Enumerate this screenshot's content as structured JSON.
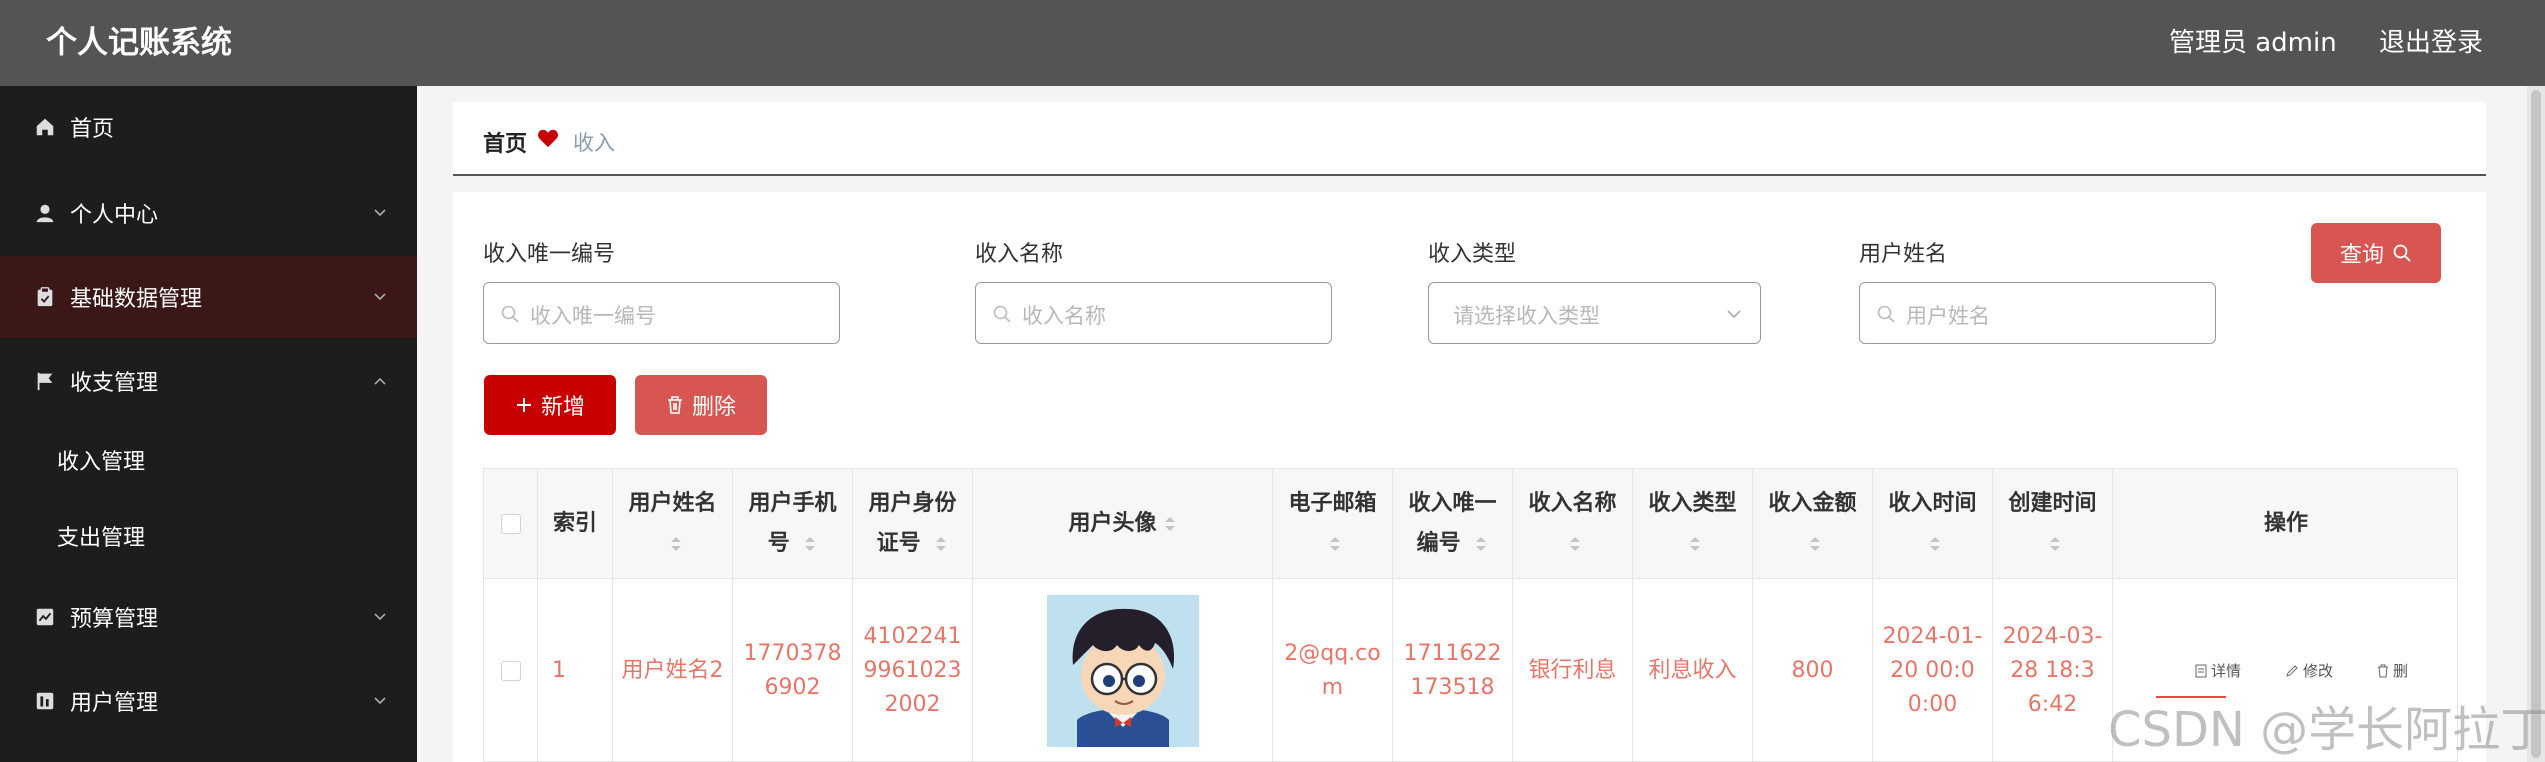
{
  "header": {
    "title": "个人记账系统",
    "user_label": "管理员 admin",
    "logout_label": "退出登录"
  },
  "sidebar": {
    "items": [
      {
        "label": "首页",
        "icon": "home-icon"
      },
      {
        "label": "个人中心",
        "icon": "user-icon"
      },
      {
        "label": "基础数据管理",
        "icon": "clipboard-icon"
      },
      {
        "label": "收支管理",
        "icon": "flag-icon"
      },
      {
        "label": "预算管理",
        "icon": "chart-icon"
      },
      {
        "label": "用户管理",
        "icon": "users-icon"
      }
    ],
    "sub_items": [
      "收入管理",
      "支出管理"
    ]
  },
  "breadcrumb": {
    "home": "首页",
    "current": "收入"
  },
  "search": {
    "fields": [
      {
        "label": "收入唯一编号",
        "placeholder": "收入唯一编号"
      },
      {
        "label": "收入名称",
        "placeholder": "收入名称"
      },
      {
        "label": "收入类型",
        "placeholder": "请选择收入类型"
      },
      {
        "label": "用户姓名",
        "placeholder": "用户姓名"
      }
    ],
    "query_label": "查询"
  },
  "actions": {
    "add_label": "新增",
    "delete_label": "删除"
  },
  "table": {
    "headers": [
      "索引",
      "用户姓名",
      "用户手机号",
      "用户身份证号",
      "用户头像",
      "电子邮箱",
      "收入唯一编号",
      "收入名称",
      "收入类型",
      "收入金额",
      "收入时间",
      "创建时间",
      "操作"
    ],
    "rows": [
      {
        "index": "1",
        "user_name": "用户姓名2",
        "phone": "17703786902",
        "id_card": "410224199610232002",
        "email": "2@qq.com",
        "income_no": "1711622173518",
        "income_name": "银行利息",
        "income_type": "利息收入",
        "amount": "800",
        "income_time": "2024-01-20 00:00:00",
        "create_time": "2024-03-28 18:36:42",
        "ops": [
          "详情",
          "修改",
          "删"
        ]
      }
    ]
  },
  "watermark": "CSDN @学长阿拉丁",
  "colors": {
    "topbar": "#545454",
    "sidebar": "#1d1d1d",
    "sidebar_active": "#3c1717",
    "primary": "#c70000",
    "secondary": "#d75652",
    "cell_text": "#e97568"
  }
}
